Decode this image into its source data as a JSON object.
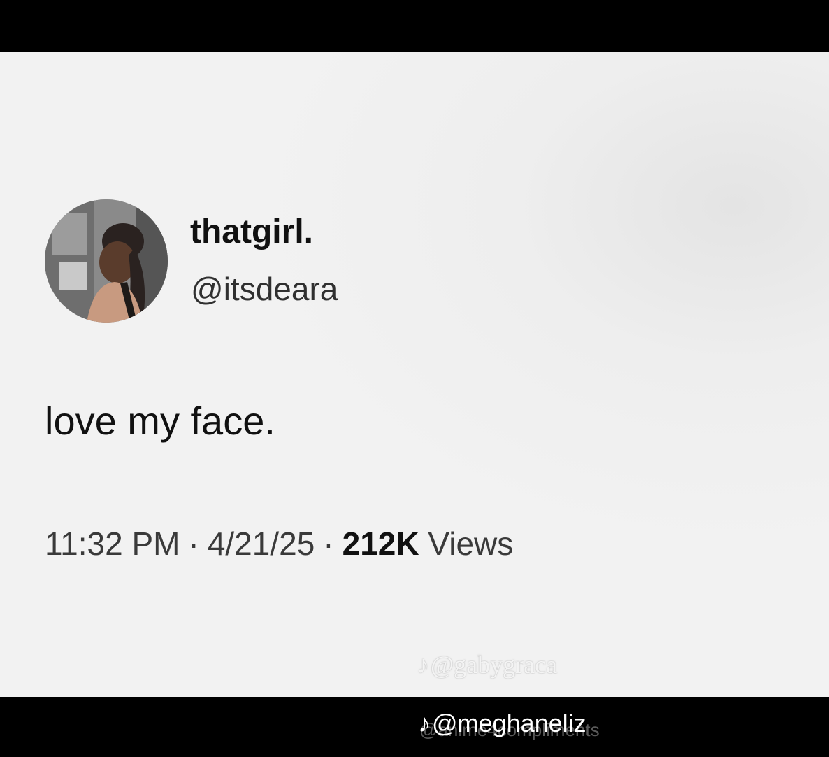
{
  "tweet": {
    "display_name": "thatgirl.",
    "handle": "@itsdeara",
    "text": "love my face.",
    "time": "11:32 PM",
    "separator": "·",
    "date": "4/21/25",
    "views_count": "212K",
    "views_label": "Views"
  },
  "watermarks": {
    "tiktok_icon": "♪",
    "faint_handle": "@gabygraca",
    "bottom_handle": "@meghaneliz",
    "ghost_handle": "@anime4compliments"
  },
  "icons": {
    "avatar": "avatar-photo",
    "tiktok": "tiktok-icon"
  }
}
